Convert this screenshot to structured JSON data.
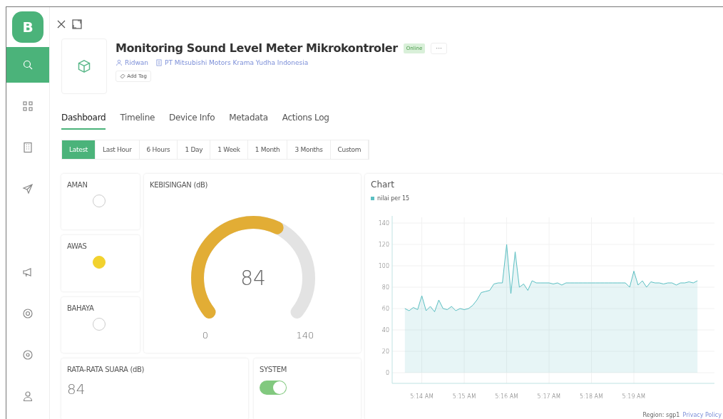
{
  "sidebar": {
    "logo": "B",
    "items": [
      {
        "kind": "search",
        "selected": true
      },
      {
        "kind": "grid",
        "selected": false
      },
      {
        "kind": "building",
        "selected": false
      },
      {
        "kind": "send",
        "selected": false
      },
      {
        "kind": "megaphone",
        "selected": false
      },
      {
        "kind": "help",
        "selected": false
      },
      {
        "kind": "settings",
        "selected": false
      },
      {
        "kind": "user",
        "selected": false
      }
    ]
  },
  "header": {
    "title": "Monitoring Sound Level Meter Mikrokontroler",
    "status": "Online",
    "more": "···",
    "owner": "Ridwan",
    "organization": "PT Mitsubishi Motors Krama Yudha Indonesia",
    "add_tag": "Add Tag"
  },
  "tabs": [
    {
      "label": "Dashboard",
      "selected": true
    },
    {
      "label": "Timeline",
      "selected": false
    },
    {
      "label": "Device Info",
      "selected": false
    },
    {
      "label": "Metadata",
      "selected": false
    },
    {
      "label": "Actions Log",
      "selected": false
    }
  ],
  "time_ranges": [
    {
      "label": "Latest",
      "selected": true
    },
    {
      "label": "Last Hour",
      "selected": false
    },
    {
      "label": "6 Hours",
      "selected": false
    },
    {
      "label": "1 Day",
      "selected": false
    },
    {
      "label": "1 Week",
      "selected": false
    },
    {
      "label": "1 Month",
      "selected": false
    },
    {
      "label": "3 Months",
      "selected": false
    },
    {
      "label": "Custom",
      "selected": false
    }
  ],
  "indicators": [
    {
      "label": "AMAN",
      "on": false
    },
    {
      "label": "AWAS",
      "on": true
    },
    {
      "label": "BAHAYA",
      "on": false
    }
  ],
  "gauge": {
    "title": "KEBISINGAN (dB)",
    "value": "84",
    "min": "0",
    "max": "140"
  },
  "average": {
    "title": "RATA-RATA SUARA (dB)",
    "value": "84"
  },
  "system": {
    "title": "SYSTEM",
    "on": true
  },
  "chart": {
    "title": "Chart",
    "chart_data": {
      "type": "area",
      "grid": true,
      "ylim": [
        0,
        140
      ],
      "yticks": [
        0,
        20,
        40,
        60,
        80,
        100,
        120,
        140
      ],
      "categories": [
        null,
        null,
        null,
        null,
        "5:14 AM",
        null,
        null,
        null,
        null,
        null,
        null,
        null,
        null,
        null,
        "5:15 AM",
        null,
        null,
        null,
        null,
        null,
        null,
        null,
        null,
        null,
        "5:16 AM",
        null,
        null,
        null,
        null,
        null,
        null,
        null,
        null,
        null,
        "5:17 AM",
        null,
        null,
        null,
        null,
        null,
        null,
        null,
        null,
        null,
        "5:18 AM",
        null,
        null,
        null,
        null,
        null,
        null,
        null,
        null,
        null,
        "5:19 AM",
        null,
        null,
        null,
        null,
        null,
        null,
        null,
        null,
        null,
        null,
        null,
        null,
        null,
        null,
        null
      ],
      "series": [
        {
          "name": "nilai per 15",
          "color": "#5bbfc2",
          "values": [
            60,
            58,
            61,
            59,
            72,
            58,
            62,
            57,
            68,
            60,
            59,
            62,
            58,
            60,
            59,
            60,
            63,
            68,
            75,
            76,
            77,
            83,
            84,
            84,
            120,
            74,
            113,
            80,
            83,
            77,
            86,
            84,
            84,
            84,
            84,
            83,
            84,
            82,
            84,
            84,
            84,
            84,
            84,
            84,
            84,
            84,
            84,
            84,
            84,
            84,
            84,
            84,
            84,
            80,
            95,
            82,
            86,
            80,
            85,
            84,
            84,
            83,
            84,
            84,
            82,
            84,
            84,
            85,
            84,
            86
          ]
        }
      ]
    }
  },
  "footer": {
    "region": "Region: sgp1",
    "privacy": "Privacy Policy"
  }
}
